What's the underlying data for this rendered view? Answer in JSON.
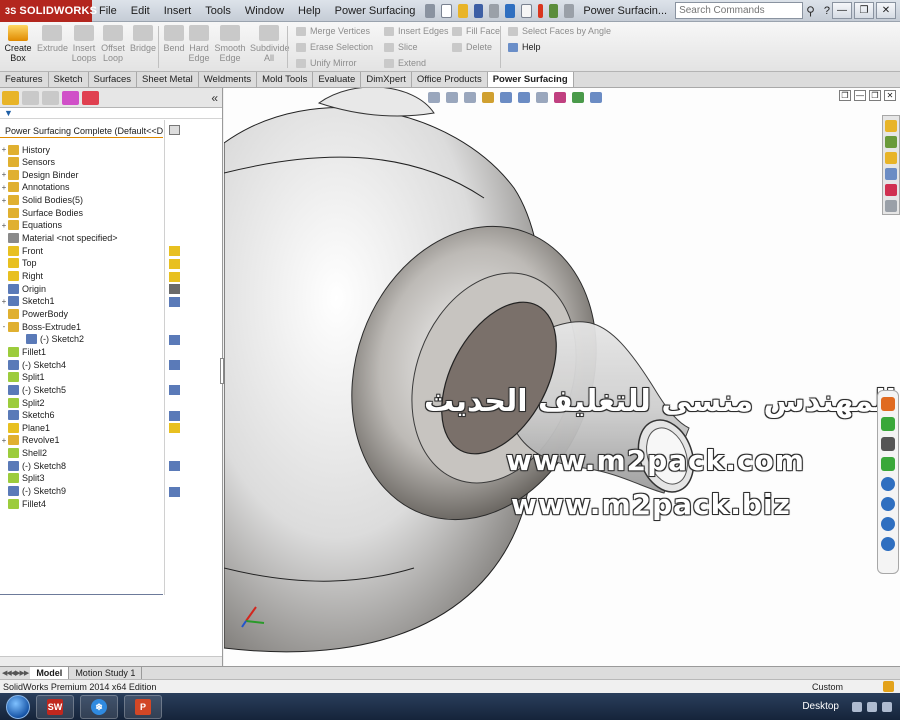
{
  "app": {
    "logo_text": "SOLIDWORKS",
    "logo_prefix": "3S",
    "menus": [
      "File",
      "Edit",
      "Insert",
      "Tools",
      "Window",
      "Help",
      "Power Surfacing"
    ],
    "document_title": "Power Surfacin...",
    "search_placeholder": "Search Commands",
    "help_label": "?"
  },
  "ribbon": {
    "big_buttons": [
      {
        "label": "Create Box",
        "active": true
      },
      {
        "label": "Extrude",
        "active": false
      },
      {
        "label": "Insert Loops",
        "active": false
      },
      {
        "label": "Offset Loop",
        "active": false
      },
      {
        "label": "Bridge",
        "active": false
      },
      {
        "label": "Bend",
        "active": false
      },
      {
        "label": "Hard Edge",
        "active": false
      },
      {
        "label": "Smooth Edge",
        "active": false
      },
      {
        "label": "Subdivide All",
        "active": false
      }
    ],
    "small_buttons": [
      {
        "label": "Merge Vertices",
        "active": false
      },
      {
        "label": "Erase Selection",
        "active": false
      },
      {
        "label": "Unify Mirror",
        "active": false
      },
      {
        "label": "Insert Edges",
        "active": false
      },
      {
        "label": "Slice",
        "active": false
      },
      {
        "label": "Extend",
        "active": false
      },
      {
        "label": "Fill Face",
        "active": false
      },
      {
        "label": "Delete",
        "active": false
      },
      {
        "label": "Select Faces by Angle",
        "active": false
      },
      {
        "label": "Help",
        "active": true
      }
    ]
  },
  "command_tabs": [
    {
      "label": "Features",
      "active": false
    },
    {
      "label": "Sketch",
      "active": false
    },
    {
      "label": "Surfaces",
      "active": false
    },
    {
      "label": "Sheet Metal",
      "active": false
    },
    {
      "label": "Weldments",
      "active": false
    },
    {
      "label": "Mold Tools",
      "active": false
    },
    {
      "label": "Evaluate",
      "active": false
    },
    {
      "label": "DimXpert",
      "active": false
    },
    {
      "label": "Office Products",
      "active": false
    },
    {
      "label": "Power Surfacing",
      "active": true
    }
  ],
  "feature_tree": {
    "root": "Power Surfacing Complete  (Default<<D",
    "items": [
      {
        "label": "History",
        "expand": "+",
        "icon_color": "#e0b030"
      },
      {
        "label": "Sensors",
        "expand": "",
        "icon_color": "#e0b030"
      },
      {
        "label": "Design Binder",
        "expand": "+",
        "icon_color": "#e0b030"
      },
      {
        "label": "Annotations",
        "expand": "+",
        "icon_color": "#e0b030"
      },
      {
        "label": "Solid Bodies(5)",
        "expand": "+",
        "icon_color": "#e0b030"
      },
      {
        "label": "Surface Bodies",
        "expand": "",
        "icon_color": "#e0b030"
      },
      {
        "label": "Equations",
        "expand": "+",
        "icon_color": "#e0b030"
      },
      {
        "label": "Material <not specified>",
        "expand": "",
        "icon_color": "#8a8a8a"
      },
      {
        "label": "Front",
        "expand": "",
        "icon_color": "#e8c020"
      },
      {
        "label": "Top",
        "expand": "",
        "icon_color": "#e8c020"
      },
      {
        "label": "Right",
        "expand": "",
        "icon_color": "#e8c020"
      },
      {
        "label": "Origin",
        "expand": "",
        "icon_color": "#5a7ab8"
      },
      {
        "label": "Sketch1",
        "expand": "+",
        "icon_color": "#5a7ab8"
      },
      {
        "label": "PowerBody",
        "expand": "",
        "icon_color": "#e0b030"
      },
      {
        "label": "Boss-Extrude1",
        "expand": "-",
        "icon_color": "#e0b030"
      },
      {
        "label": "(-) Sketch2",
        "expand": "",
        "icon_color": "#5a7ab8",
        "indent": true
      },
      {
        "label": "Fillet1",
        "expand": "",
        "icon_color": "#9ccc3c"
      },
      {
        "label": "(-) Sketch4",
        "expand": "",
        "icon_color": "#5a7ab8"
      },
      {
        "label": "Split1",
        "expand": "",
        "icon_color": "#9ccc3c"
      },
      {
        "label": "(-) Sketch5",
        "expand": "",
        "icon_color": "#5a7ab8"
      },
      {
        "label": "Split2",
        "expand": "",
        "icon_color": "#9ccc3c"
      },
      {
        "label": "Sketch6",
        "expand": "",
        "icon_color": "#5a7ab8"
      },
      {
        "label": "Plane1",
        "expand": "",
        "icon_color": "#e8c020"
      },
      {
        "label": "Revolve1",
        "expand": "+",
        "icon_color": "#e0b030"
      },
      {
        "label": "Shell2",
        "expand": "",
        "icon_color": "#9ccc3c"
      },
      {
        "label": "(-) Sketch8",
        "expand": "",
        "icon_color": "#5a7ab8"
      },
      {
        "label": "Split3",
        "expand": "",
        "icon_color": "#9ccc3c"
      },
      {
        "label": "(-) Sketch9",
        "expand": "",
        "icon_color": "#5a7ab8"
      },
      {
        "label": "Fillet4",
        "expand": "",
        "icon_color": "#9ccc3c"
      }
    ]
  },
  "watermark": {
    "arabic": "شركة المهندس منسى للتغليف الحديث",
    "site1": "www.m2pack.com",
    "site2": "www.m2pack.biz"
  },
  "bottom_tabs": [
    {
      "label": "Model",
      "active": true
    },
    {
      "label": "Motion Study 1",
      "active": false
    }
  ],
  "status": {
    "edition": "SolidWorks Premium 2014 x64 Edition",
    "units": "Custom"
  },
  "taskbar": {
    "desktop_label": "Desktop"
  },
  "colors": {
    "accent": "#e08a00",
    "brand_red": "#b3261e"
  }
}
